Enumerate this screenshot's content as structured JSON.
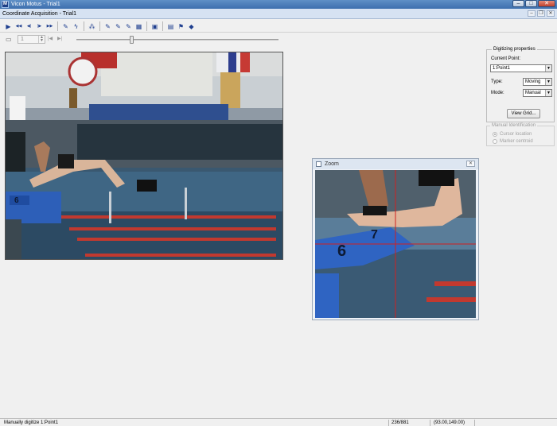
{
  "window": {
    "app_title": "Vicon Motus - Trial1",
    "app_icon": "M",
    "minimize": "–",
    "maximize": "□",
    "close": "✕"
  },
  "document": {
    "title": "Coordinate Acquisition - Trial1",
    "minimize": "–",
    "restore": "❐",
    "close": "✕"
  },
  "toolbar": {
    "icons": [
      "play-icon",
      "rewind-icon",
      "step-back-icon",
      "step-forward-icon",
      "fast-forward-icon",
      "marker-icon",
      "auto-track-icon",
      "smooth-icon",
      "pencil-icon",
      "digitize-icon",
      "digitize-all-icon",
      "film-icon",
      "camera-icon",
      "properties-icon",
      "flag-icon",
      "eraser-icon"
    ],
    "glyphs": [
      "▶",
      "◀◀",
      "◀|",
      "|▶",
      "▶▶",
      "✎",
      "ϟ",
      "⁂",
      "✎",
      "✎",
      "✎",
      "▦",
      "▣",
      "▤",
      "⚑",
      "◆"
    ]
  },
  "frame_nav": {
    "camera_glyph": "▭",
    "frame_value": "1",
    "prev": "|◀",
    "next": "▶|",
    "slider_fraction": 0.27
  },
  "zoom": {
    "title": "Zoom",
    "close": "✕"
  },
  "panel": {
    "group_title": "Digitizing properties",
    "current_point_label": "Current Point:",
    "current_point_value": "1:Point1",
    "type_label": "Type:",
    "type_value": "Moving",
    "mode_label": "Mode:",
    "mode_value": "Manual",
    "view_grid_button": "View Grid..."
  },
  "manual_identification": {
    "group_title": "Manual Identification",
    "option_cursor": "Cursor location",
    "option_marker": "Marker centroid"
  },
  "status": {
    "message": "Manually digitize 1:Point1",
    "frame": "236/881",
    "coords": "(93.00,149.00)"
  }
}
